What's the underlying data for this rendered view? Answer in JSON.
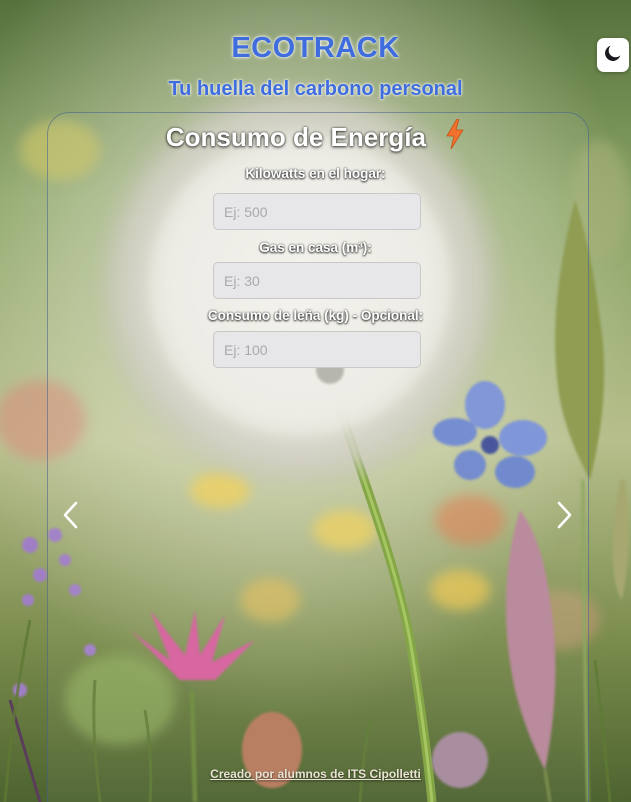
{
  "header": {
    "brand": "ECOTRACK",
    "tagline": "Tu huella del carbono personal"
  },
  "theme_toggle": {
    "icon": "moon-icon"
  },
  "slide": {
    "title": "Consumo de Energía",
    "title_icon": "lightning-bolt-icon",
    "fields": [
      {
        "label": "Kilowatts en el hogar:",
        "placeholder": "Ej: 500",
        "value": ""
      },
      {
        "label": "Gas en casa (m³):",
        "placeholder": "Ej: 30",
        "value": ""
      },
      {
        "label": "Consumo de leña (kg) - Opcional:",
        "placeholder": "Ej: 100",
        "value": ""
      }
    ]
  },
  "carousel": {
    "prev_icon": "chevron-left-icon",
    "next_icon": "chevron-right-icon"
  },
  "footer": {
    "credit": "Creado por alumnos de ITS Cipolletti"
  },
  "colors": {
    "brand": "#3f6dde",
    "bolt": "#f2712c"
  }
}
